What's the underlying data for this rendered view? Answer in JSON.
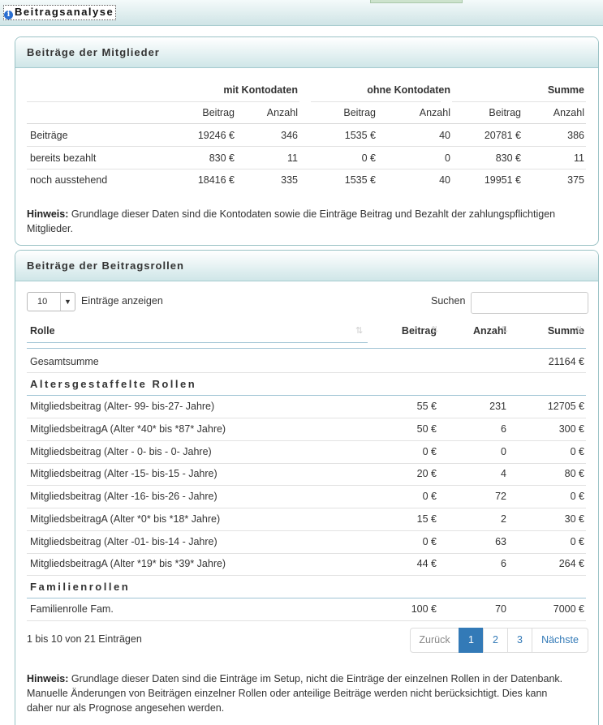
{
  "app": {
    "title": "Beitragsanalyse"
  },
  "members": {
    "header": "Beiträge der Mitglieder",
    "groups": [
      "mit Kontodaten",
      "ohne Kontodaten",
      "Summe"
    ],
    "subheaders": [
      "Beitrag",
      "Anzahl",
      "Beitrag",
      "Anzahl",
      "Beitrag",
      "Anzahl"
    ],
    "rows": [
      {
        "label": "Beiträge",
        "values": [
          "19246 €",
          "346",
          "1535 €",
          "40",
          "20781 €",
          "386"
        ]
      },
      {
        "label": "bereits bezahlt",
        "values": [
          "830 €",
          "11",
          "0 €",
          "0",
          "830 €",
          "11"
        ]
      },
      {
        "label": "noch ausstehend",
        "values": [
          "18416 €",
          "335",
          "1535 €",
          "40",
          "19951 €",
          "375"
        ]
      }
    ],
    "hint_label": "Hinweis:",
    "hint_line1": "Grundlage dieser Daten sind die Kontodaten sowie die Einträge Beitrag und Bezahlt der zahlungspflichtigen",
    "hint_line2": "Mitglieder."
  },
  "roles": {
    "header": "Beiträge der Beitragsrollen",
    "length_value": "10",
    "length_label": "Einträge anzeigen",
    "search_label": "Suchen",
    "search_value": "",
    "columns": [
      "Rolle",
      "Beitrag",
      "Anzahl",
      "Summe"
    ],
    "total_label": "Gesamtsumme",
    "total_value": "21164 €",
    "groups": [
      {
        "title": "Altersgestaffelte Rollen",
        "rows": [
          {
            "role": "Mitgliedsbeitrag (Alter- 99- bis-27- Jahre)",
            "beitrag": "55 €",
            "anzahl": "231",
            "summe": "12705 €"
          },
          {
            "role": "MitgliedsbeitragA (Alter *40* bis *87* Jahre)",
            "beitrag": "50 €",
            "anzahl": "6",
            "summe": "300 €"
          },
          {
            "role": "Mitgliedsbeitrag (Alter - 0- bis - 0- Jahre)",
            "beitrag": "0 €",
            "anzahl": "0",
            "summe": "0 €"
          },
          {
            "role": "Mitgliedsbeitrag (Alter -15- bis-15 - Jahre)",
            "beitrag": "20 €",
            "anzahl": "4",
            "summe": "80 €"
          },
          {
            "role": "Mitgliedsbeitrag (Alter -16- bis-26 - Jahre)",
            "beitrag": "0 €",
            "anzahl": "72",
            "summe": "0 €"
          },
          {
            "role": "MitgliedsbeitragA (Alter *0* bis *18* Jahre)",
            "beitrag": "15 €",
            "anzahl": "2",
            "summe": "30 €"
          },
          {
            "role": "Mitgliedsbeitrag (Alter -01- bis-14 - Jahre)",
            "beitrag": "0 €",
            "anzahl": "63",
            "summe": "0 €"
          },
          {
            "role": "MitgliedsbeitragA (Alter *19* bis *39* Jahre)",
            "beitrag": "44 €",
            "anzahl": "6",
            "summe": "264 €"
          }
        ]
      },
      {
        "title": "Familienrollen",
        "rows": [
          {
            "role": "Familienrolle Fam.",
            "beitrag": "100 €",
            "anzahl": "70",
            "summe": "7000 €"
          }
        ]
      }
    ],
    "info": "1 bis 10 von 21 Einträgen",
    "pagination": {
      "prev": "Zurück",
      "pages": [
        "1",
        "2",
        "3"
      ],
      "next": "Nächste"
    },
    "hint_label": "Hinweis:",
    "hint_line1": "Grundlage dieser Daten sind die Einträge im Setup, nicht die Einträge der einzelnen Rollen in der Datenbank.",
    "hint_line2": "Manuelle Änderungen von Beiträgen einzelner Rollen oder anteilige Beiträge werden nicht berücksichtigt. Dies kann",
    "hint_line3": "daher nur als Prognose angesehen werden."
  }
}
